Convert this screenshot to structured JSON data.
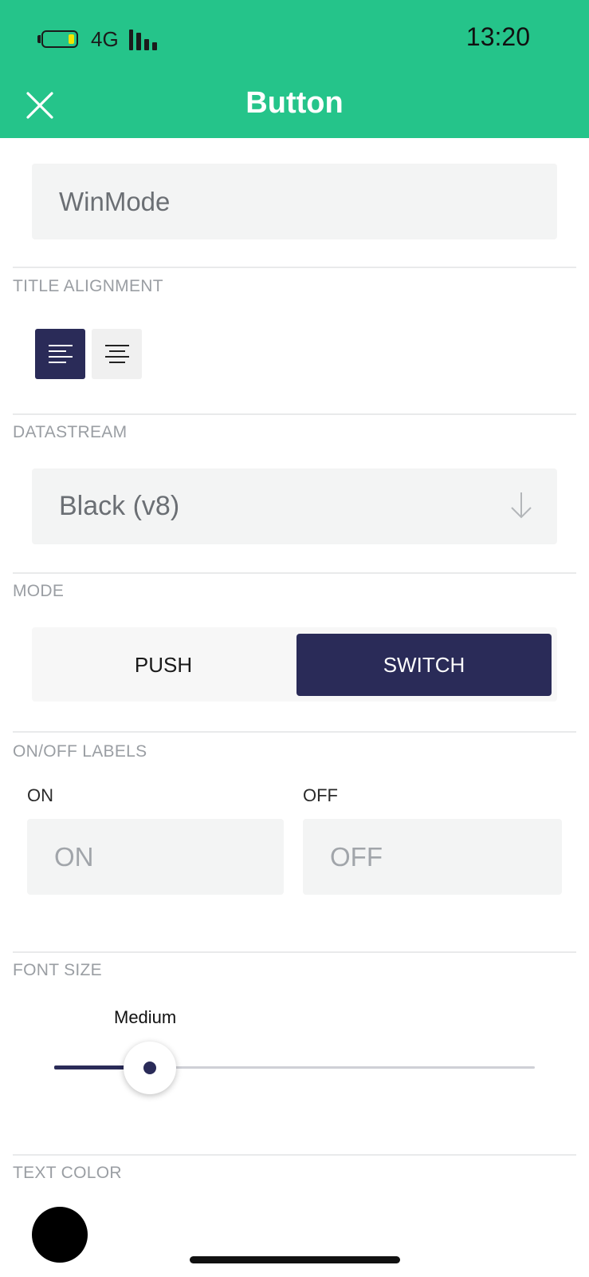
{
  "status_bar": {
    "network": "4G",
    "time": "13:20",
    "battery_fill_color": "#f2e600"
  },
  "header": {
    "title": "Button",
    "close_icon": "close-icon",
    "background": "#25c48a"
  },
  "widget_name": {
    "value": "WinMode"
  },
  "title_alignment": {
    "label": "TITLE ALIGNMENT",
    "options": [
      {
        "icon": "align-left-icon",
        "selected": true
      },
      {
        "icon": "align-center-icon",
        "selected": false
      }
    ]
  },
  "datastream": {
    "label": "DATASTREAM",
    "value": "Black (v8)",
    "icon": "arrow-down-icon"
  },
  "mode": {
    "label": "MODE",
    "options": [
      "PUSH",
      "SWITCH"
    ],
    "selected": "SWITCH"
  },
  "onoff_labels": {
    "label": "ON/OFF LABELS",
    "on": {
      "label": "ON",
      "placeholder": "ON"
    },
    "off": {
      "label": "OFF",
      "placeholder": "OFF"
    }
  },
  "font_size": {
    "label": "FONT SIZE",
    "value_label": "Medium",
    "level": 0.2
  },
  "text_color": {
    "label": "TEXT COLOR",
    "value": "#000000"
  },
  "colors": {
    "accent": "#2a2b58",
    "header": "#25c48a"
  }
}
